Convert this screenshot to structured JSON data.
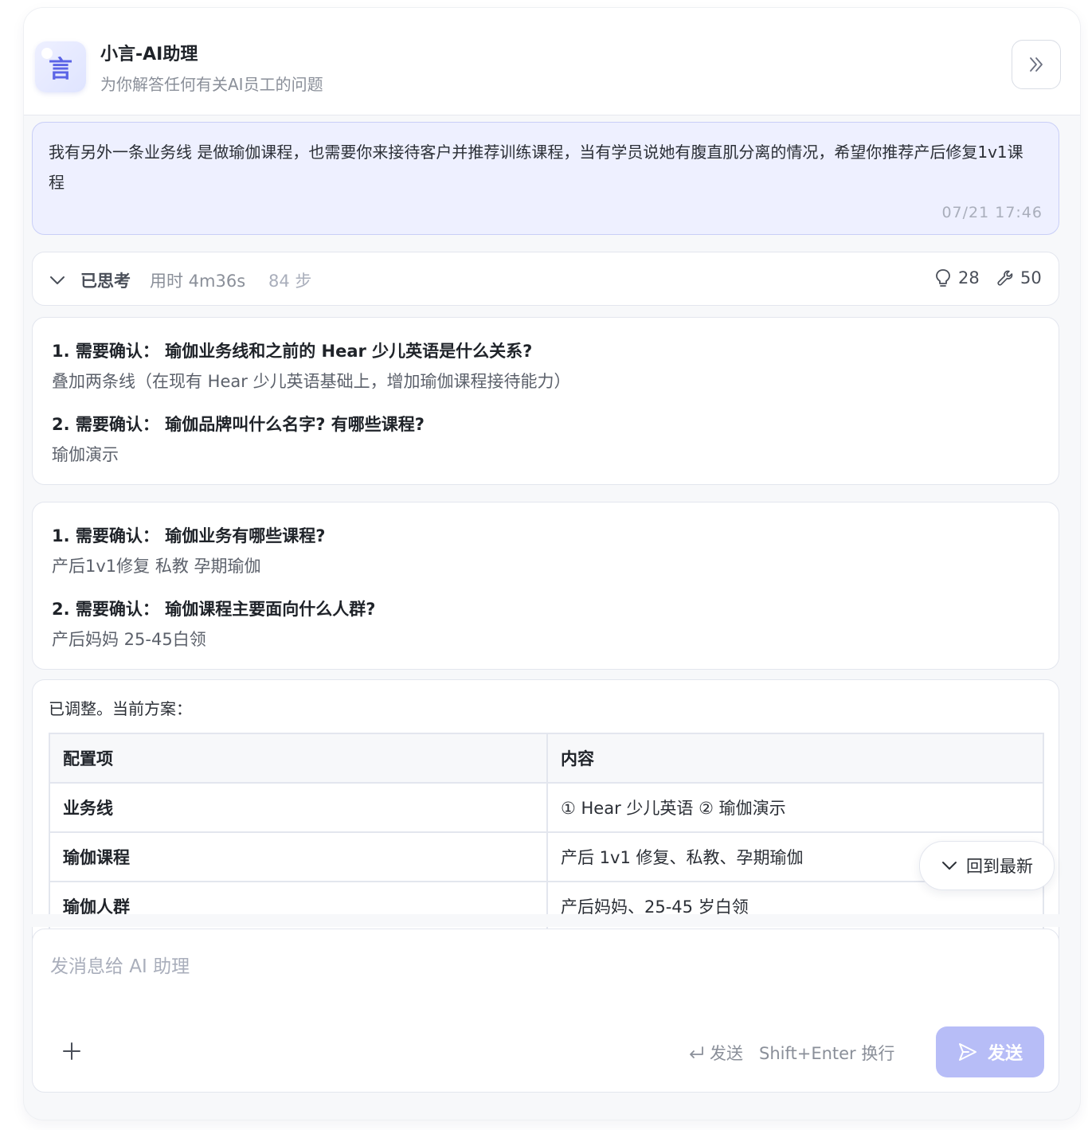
{
  "header": {
    "avatar_char": "言",
    "title": "小言-AI助理",
    "subtitle": "为你解答任何有关AI员工的问题"
  },
  "user_message": {
    "text": "我有另外一条业务线 是做瑜伽课程，也需要你来接待客户并推荐训练课程，当有学员说她有腹直肌分离的情况，希望你推荐产后修复1v1课程",
    "time": "07/21 17:46"
  },
  "thinking": {
    "label": "已思考",
    "duration": "用时 4m36s",
    "steps": "84 步",
    "ideas_count": "28",
    "tools_count": "50"
  },
  "qa_block_1": [
    {
      "q": "1. 需要确认：  瑜伽业务线和之前的 Hear 少儿英语是什么关系?",
      "a": "叠加两条线（在现有 Hear 少儿英语基础上，增加瑜伽课程接待能力）"
    },
    {
      "q": "2. 需要确认：  瑜伽品牌叫什么名字? 有哪些课程?",
      "a": "瑜伽演示"
    }
  ],
  "qa_block_2": [
    {
      "q": "1. 需要确认：  瑜伽业务有哪些课程?",
      "a": "产后1v1修复 私教 孕期瑜伽"
    },
    {
      "q": "2. 需要确认：  瑜伽课程主要面向什么人群?",
      "a": "产后妈妈 25-45白领"
    }
  ],
  "plan": {
    "intro": "已调整。当前方案：",
    "columns": [
      "配置项",
      "内容"
    ],
    "rows": [
      [
        "业务线",
        "① Hear 少儿英语 ② 瑜伽演示"
      ],
      [
        "瑜伽课程",
        "产后 1v1 修复、私教、孕期瑜伽"
      ],
      [
        "瑜伽人群",
        "产后妈妈、25-45 岁白领"
      ]
    ]
  },
  "scroll_to_latest": "回到最新",
  "composer": {
    "placeholder": "发消息给 AI 助理",
    "send_hint": "发送",
    "newline_hint": "Shift+Enter 换行",
    "send_label": "发送"
  },
  "colors": {
    "accent": "#5b64e6",
    "send_button": "#b7bdf7",
    "user_bubble": "#eef0ff"
  },
  "icons": [
    "chat-avatar-icon",
    "double-chevron-right-icon",
    "chevron-down-icon",
    "lightbulb-icon",
    "wrench-icon",
    "plus-icon",
    "enter-key-icon",
    "send-icon"
  ]
}
